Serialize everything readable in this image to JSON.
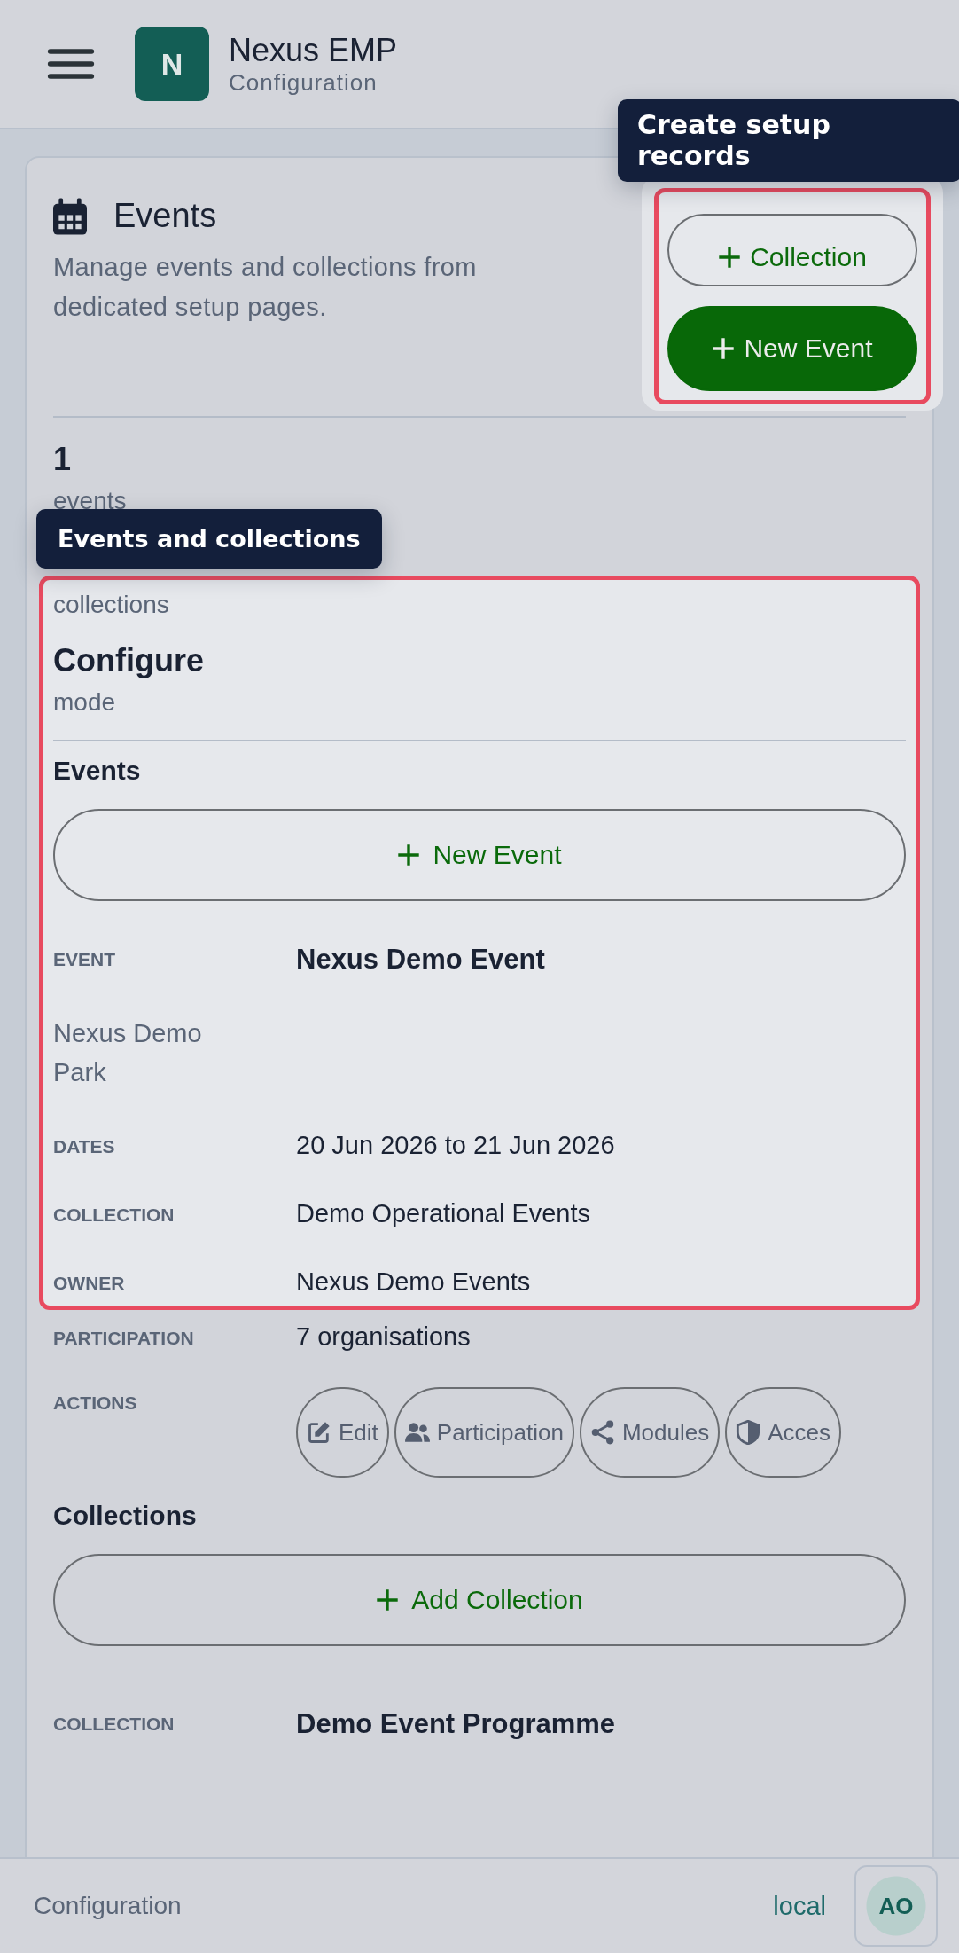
{
  "header": {
    "logo_letter": "N",
    "app_name": "Nexus EMP",
    "section": "Configuration"
  },
  "page": {
    "title": "Events",
    "description": "Manage events and collections from dedicated setup pages."
  },
  "action_highlight": {
    "tooltip": "Create setup records",
    "buttons": [
      {
        "label": "Collection",
        "kind": "outline"
      },
      {
        "label": "New Event",
        "kind": "primary"
      }
    ]
  },
  "stats": [
    {
      "value": "1",
      "label": "events"
    }
  ],
  "section_highlight": {
    "tooltip": "Events and collections",
    "stats": [
      {
        "label": "collections"
      },
      {
        "value": "Configure",
        "label": "mode"
      }
    ],
    "events": {
      "heading": "Events",
      "add_button": "New Event",
      "fields": [
        {
          "kind": "title",
          "label": "EVENT",
          "value": "Nexus Demo Event"
        },
        {
          "kind": "subtitle",
          "label": "Nexus Demo Park"
        },
        {
          "kind": "plain",
          "label": "DATES",
          "value": "20 Jun 2026 to 21 Jun 2026"
        },
        {
          "kind": "plain",
          "label": "COLLECTION",
          "value": "Demo Operational Events"
        },
        {
          "kind": "plain",
          "label": "OWNER",
          "value": "Nexus Demo Events"
        }
      ]
    }
  },
  "more_fields": [
    {
      "label": "PARTICIPATION",
      "value": "7 organisations"
    }
  ],
  "actions": {
    "label": "ACTIONS",
    "buttons": [
      {
        "label": "Edit",
        "kind": "edit"
      },
      {
        "label": "Participation",
        "kind": "people"
      },
      {
        "label": "Modules",
        "kind": "share"
      },
      {
        "label": "Acces",
        "kind": "shield"
      }
    ]
  },
  "collections": {
    "heading": "Collections",
    "add_button": "Add Collection",
    "fields": [
      {
        "kind": "title",
        "label": "COLLECTION",
        "value": "Demo Event Programme"
      }
    ]
  },
  "footer": {
    "section": "Configuration",
    "environment": "local",
    "avatar": "AO"
  }
}
